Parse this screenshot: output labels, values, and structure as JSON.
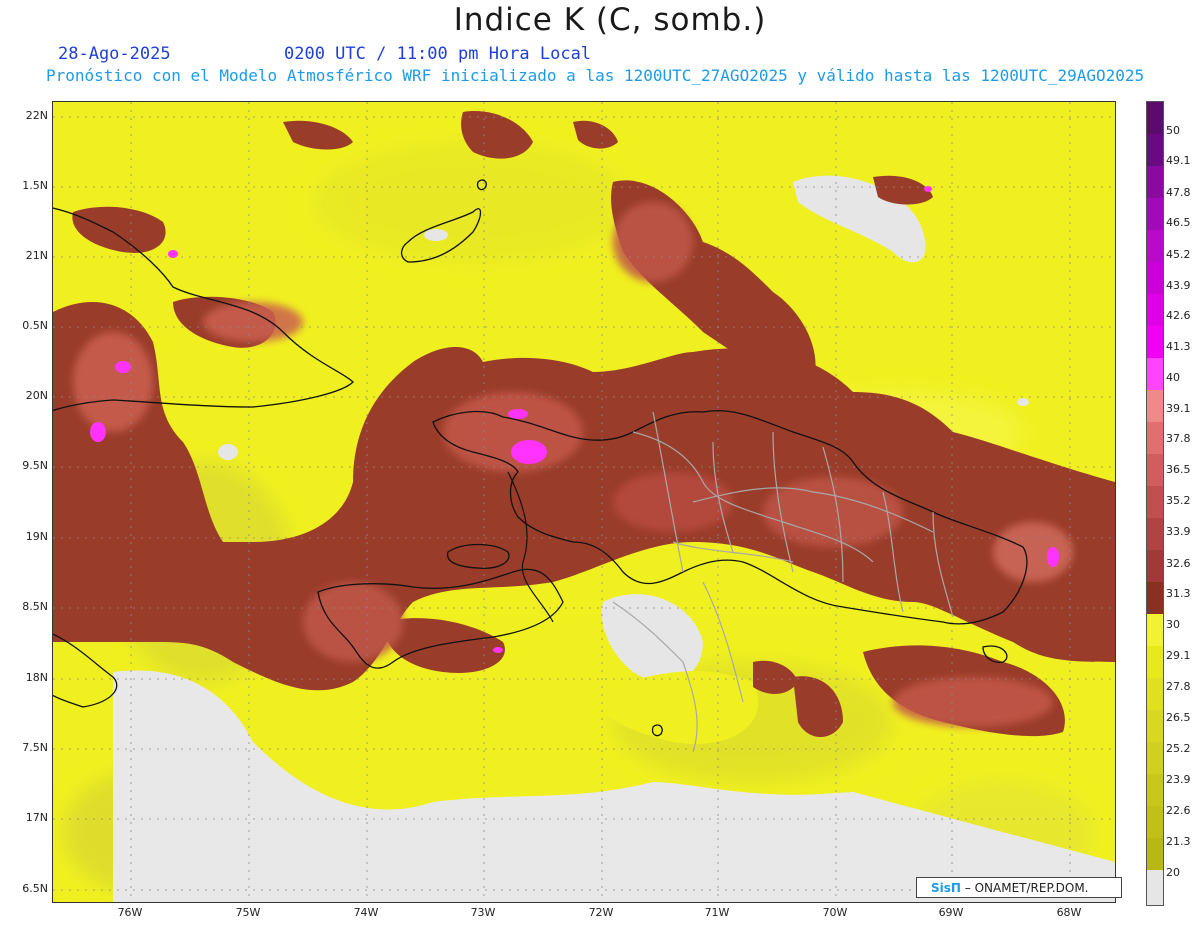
{
  "header": {
    "title": "Indice K (C, somb.)",
    "date": "28-Ago-2025",
    "time": "0200 UTC / 11:00 pm Hora Local",
    "subtitle": "Pronóstico con el Modelo Atmosférico WRF inicializado a las 1200UTC_27AGO2025 y válido hasta las  1200UTC_29AGO2025"
  },
  "axes": {
    "lat_labels": [
      "22N",
      "1.5N",
      "21N",
      "0.5N",
      "20N",
      "9.5N",
      "19N",
      "8.5N",
      "18N",
      "7.5N",
      "17N",
      "6.5N"
    ],
    "lon_labels": [
      "76W",
      "75W",
      "74W",
      "73W",
      "72W",
      "71W",
      "70W",
      "69W",
      "68W"
    ]
  },
  "colorbar": {
    "labels": [
      "50",
      "49.1",
      "47.8",
      "46.5",
      "45.2",
      "43.9",
      "42.6",
      "41.3",
      "40",
      "39.1",
      "37.8",
      "36.5",
      "35.2",
      "33.9",
      "32.6",
      "31.3",
      "30",
      "29.1",
      "27.8",
      "26.5",
      "25.2",
      "23.9",
      "22.6",
      "21.3",
      "20"
    ],
    "colors": [
      "#5c0a6e",
      "#6a0a80",
      "#8a0aa0",
      "#a00ab8",
      "#b80ac8",
      "#cc00d8",
      "#e000e8",
      "#f000f4",
      "#ff44ff",
      "#f08a8a",
      "#e07070",
      "#d05e5e",
      "#c05050",
      "#b04444",
      "#a03a38",
      "#8a3020",
      "#f2f232",
      "#e8e81e",
      "#e0e020",
      "#d8d822",
      "#d0d020",
      "#c8c81c",
      "#c0c018",
      "#b8b814",
      "#e6e6e6"
    ]
  },
  "credit": {
    "logo": "SisΠ",
    "text": "– ONAMET/REP.DOM."
  },
  "colors": {
    "land_yellow": "#f0f020",
    "land_bright": "#f5f53c",
    "brown": "#9a3c2a",
    "salmon": "#d86a5a",
    "magenta": "#ff33ff",
    "gray_land": "#e8e8e8",
    "coast": "#111111",
    "provinces": "#a0a0a0"
  }
}
